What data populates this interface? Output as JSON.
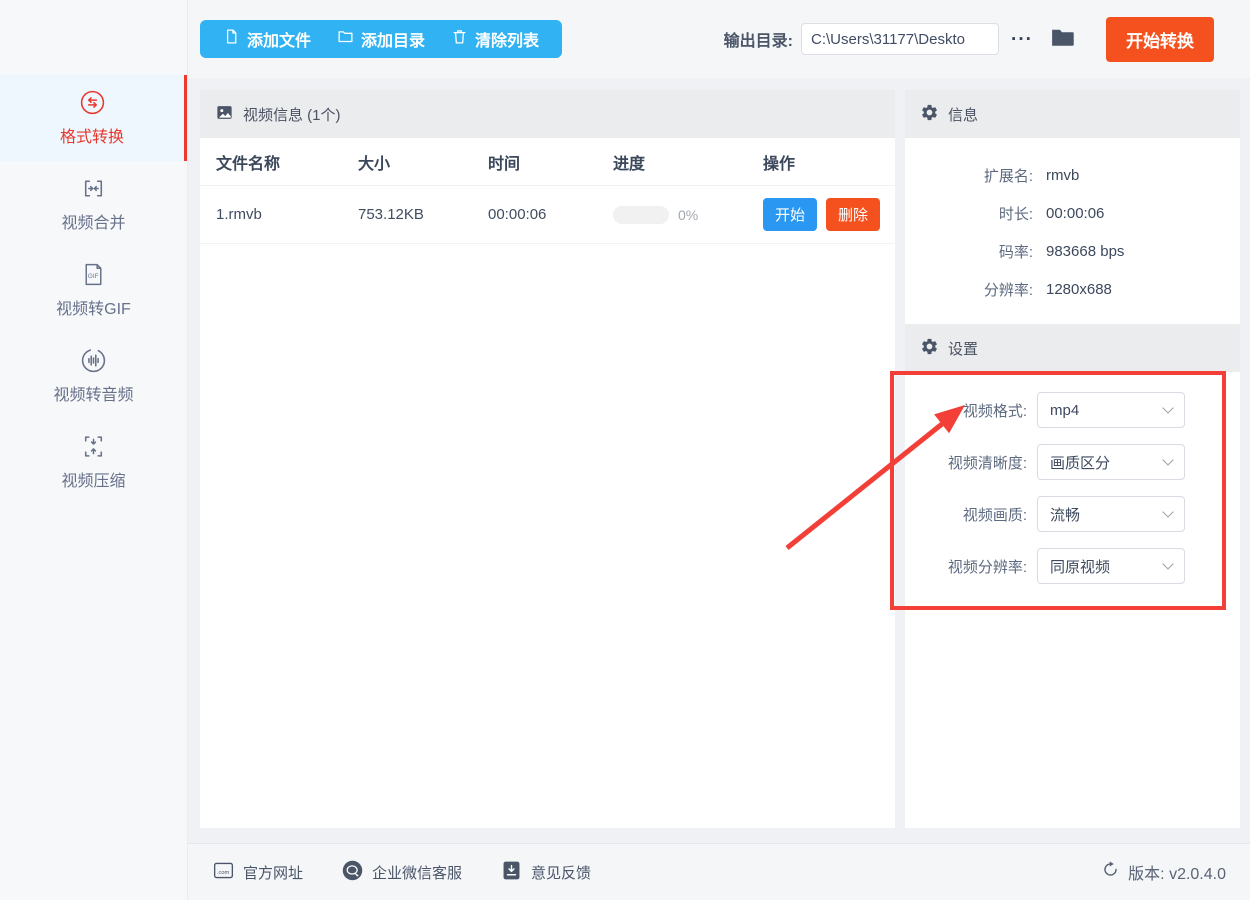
{
  "toolbar": {
    "add_file": "添加文件",
    "add_dir": "添加目录",
    "clear_list": "清除列表",
    "output_dir_label": "输出目录:",
    "output_dir_value": "C:\\Users\\31177\\Deskto",
    "more_label": "···",
    "start_convert": "开始转换"
  },
  "sidebar": {
    "items": [
      {
        "label": "格式转换",
        "active": true
      },
      {
        "label": "视频合并",
        "active": false
      },
      {
        "label": "视频转GIF",
        "active": false
      },
      {
        "label": "视频转音频",
        "active": false
      },
      {
        "label": "视频压缩",
        "active": false
      }
    ]
  },
  "file_panel": {
    "title": "视频信息 (1个)",
    "columns": [
      "文件名称",
      "大小",
      "时间",
      "进度",
      "操作"
    ],
    "rows": [
      {
        "name": "1.rmvb",
        "size": "753.12KB",
        "time": "00:00:06",
        "progress_percent": 0,
        "progress": "0%",
        "start_label": "开始",
        "delete_label": "删除"
      }
    ]
  },
  "info_panel": {
    "title": "信息",
    "fields": [
      {
        "label": "扩展名:",
        "value": "rmvb"
      },
      {
        "label": "时长:",
        "value": "00:00:06"
      },
      {
        "label": "码率:",
        "value": "983668 bps"
      },
      {
        "label": "分辨率:",
        "value": "1280x688"
      }
    ]
  },
  "settings_panel": {
    "title": "设置",
    "fields": [
      {
        "label": "视频格式:",
        "value": "mp4"
      },
      {
        "label": "视频清晰度:",
        "value": "画质区分"
      },
      {
        "label": "视频画质:",
        "value": "流畅"
      },
      {
        "label": "视频分辨率:",
        "value": "同原视频"
      }
    ]
  },
  "footer": {
    "website": "官方网址",
    "wechat": "企业微信客服",
    "feedback": "意见反馈",
    "version": "版本: v2.0.4.0"
  },
  "colors": {
    "toolbar_blue": "#31b2f2",
    "action_blue": "#2a97f3",
    "orange": "#f4511e",
    "sidebar_active_red": "#ee3a2c",
    "annotation_red": "#f23f38"
  }
}
